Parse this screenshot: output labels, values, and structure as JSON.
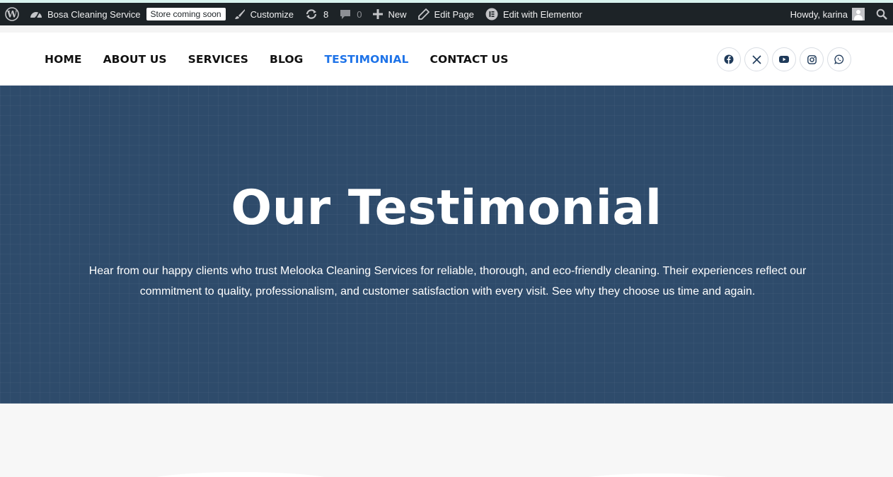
{
  "admin_bar": {
    "site_name": "Bosa Cleaning Service",
    "store_badge": "Store coming soon",
    "customize": "Customize",
    "updates_count": "8",
    "comments_count": "0",
    "new": "New",
    "edit_page": "Edit Page",
    "edit_elementor": "Edit with Elementor",
    "howdy": "Howdy, karina"
  },
  "nav": {
    "items": [
      {
        "label": "HOME"
      },
      {
        "label": "ABOUT US"
      },
      {
        "label": "SERVICES"
      },
      {
        "label": "BLOG"
      },
      {
        "label": "TESTIMONIAL",
        "active": true
      },
      {
        "label": "CONTACT US"
      }
    ]
  },
  "social": [
    "facebook-icon",
    "x-icon",
    "youtube-icon",
    "instagram-icon",
    "whatsapp-icon"
  ],
  "hero": {
    "title": "Our Testimonial",
    "text": "Hear from our happy clients who trust Melooka Cleaning Services for reliable, thorough, and eco-friendly cleaning. Their experiences reflect our commitment to quality, professionalism, and customer satisfaction with every visit. See why they choose us time and again."
  },
  "colors": {
    "admin_bg": "#1d2327",
    "hero_bg": "#2e4b6b",
    "nav_active": "#1e73e8",
    "social_icon": "#1f3a5a"
  }
}
